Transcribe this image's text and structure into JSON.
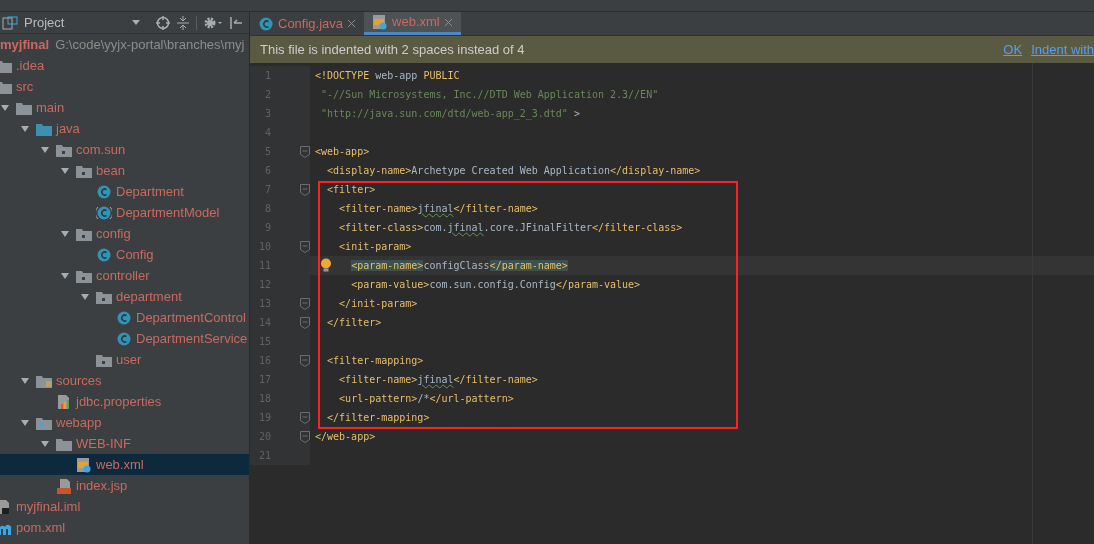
{
  "project_panel": {
    "title": "Project",
    "root": {
      "name": "myjfinal",
      "path": "G:\\code\\yyjx-portal\\branches\\myj"
    },
    "tree": [
      {
        "name": ".idea",
        "kind": "folder",
        "selected": false
      },
      {
        "name": "src",
        "kind": "folder",
        "selected": false,
        "children": [
          {
            "name": "main",
            "kind": "folder",
            "expanded": true,
            "selected": false,
            "children": [
              {
                "name": "java",
                "kind": "source-folder",
                "expanded": true,
                "selected": false,
                "children": [
                  {
                    "name": "com.sun",
                    "kind": "package",
                    "expanded": true,
                    "selected": false,
                    "children": [
                      {
                        "name": "bean",
                        "kind": "package",
                        "expanded": true,
                        "selected": false,
                        "children": [
                          {
                            "name": "Department",
                            "kind": "class",
                            "selected": false
                          },
                          {
                            "name": "DepartmentModel",
                            "kind": "abstract-class",
                            "selected": false
                          }
                        ]
                      },
                      {
                        "name": "config",
                        "kind": "package",
                        "expanded": true,
                        "selected": false,
                        "children": [
                          {
                            "name": "Config",
                            "kind": "class",
                            "selected": false
                          }
                        ]
                      },
                      {
                        "name": "controller",
                        "kind": "package",
                        "expanded": true,
                        "selected": false,
                        "children": [
                          {
                            "name": "department",
                            "kind": "package",
                            "expanded": true,
                            "selected": false,
                            "children": [
                              {
                                "name": "DepartmentControl",
                                "kind": "class",
                                "selected": false
                              },
                              {
                                "name": "DepartmentService",
                                "kind": "class",
                                "selected": false
                              }
                            ]
                          },
                          {
                            "name": "user",
                            "kind": "package",
                            "selected": false
                          }
                        ]
                      }
                    ]
                  }
                ]
              },
              {
                "name": "sources",
                "kind": "resource-folder",
                "expanded": true,
                "selected": false,
                "children": [
                  {
                    "name": "jdbc.properties",
                    "kind": "properties",
                    "selected": false
                  }
                ]
              },
              {
                "name": "webapp",
                "kind": "web-folder",
                "expanded": true,
                "selected": false,
                "children": [
                  {
                    "name": "WEB-INF",
                    "kind": "folder",
                    "expanded": true,
                    "selected": false,
                    "children": [
                      {
                        "name": "web.xml",
                        "kind": "xml",
                        "selected": true
                      }
                    ]
                  },
                  {
                    "name": "index.jsp",
                    "kind": "jsp",
                    "selected": false
                  }
                ]
              }
            ]
          }
        ]
      },
      {
        "name": "myjfinal.iml",
        "kind": "iml",
        "selected": false
      },
      {
        "name": "pom.xml",
        "kind": "maven",
        "selected": false
      }
    ]
  },
  "tabs": [
    {
      "label": "Config.java",
      "kind": "class",
      "selected": false
    },
    {
      "label": "web.xml",
      "kind": "xml",
      "selected": true
    }
  ],
  "notification": {
    "message": "This file is indented with 2 spaces instead of 4",
    "actions": [
      "OK",
      "Indent with"
    ]
  },
  "editor": {
    "lines": [
      {
        "number": "1",
        "fold": false,
        "current": false,
        "segments": [
          {
            "kind": "tag",
            "text": "<!DOCTYPE "
          },
          {
            "kind": "text",
            "text": "web-app "
          },
          {
            "kind": "tag",
            "text": "PUBLIC"
          }
        ]
      },
      {
        "number": "2",
        "fold": false,
        "current": false,
        "segments": [
          {
            "kind": "string",
            "text": " \"-//Sun Microsystems, Inc.//DTD Web Application 2.3//EN\""
          }
        ]
      },
      {
        "number": "3",
        "fold": false,
        "current": false,
        "segments": [
          {
            "kind": "string",
            "text": " \"http://java.sun.com/dtd/web-app_2_3.dtd\""
          },
          {
            "kind": "text",
            "text": " >"
          }
        ]
      },
      {
        "number": "4",
        "fold": false,
        "current": false
      },
      {
        "number": "5",
        "fold": true,
        "current": false,
        "segments": [
          {
            "kind": "tag",
            "text": "<web-app>"
          }
        ]
      },
      {
        "number": "6",
        "fold": false,
        "current": false,
        "segments": [
          {
            "kind": "tag",
            "text": "  <display-name>"
          },
          {
            "kind": "text",
            "text": "Archetype Created Web Application"
          },
          {
            "kind": "tag",
            "text": "</display-name>"
          }
        ]
      },
      {
        "number": "7",
        "fold": true,
        "current": false,
        "segments": [
          {
            "kind": "tag",
            "text": "  <filter>"
          }
        ]
      },
      {
        "number": "8",
        "fold": false,
        "current": false,
        "segments": [
          {
            "kind": "tag",
            "text": "    <filter-name>"
          },
          {
            "kind": "text",
            "text": "jfinal",
            "typo": true
          },
          {
            "kind": "tag",
            "text": "</filter-name>"
          }
        ]
      },
      {
        "number": "9",
        "fold": false,
        "current": false,
        "segments": [
          {
            "kind": "tag",
            "text": "    <filter-class>"
          },
          {
            "kind": "text",
            "text": "com."
          },
          {
            "kind": "text",
            "text": "jfinal",
            "typo": true
          },
          {
            "kind": "text",
            "text": ".core.JFinalFilter"
          },
          {
            "kind": "tag",
            "text": "</filter-class>"
          }
        ]
      },
      {
        "number": "10",
        "fold": true,
        "current": false,
        "segments": [
          {
            "kind": "tag",
            "text": "    <init-param>"
          }
        ]
      },
      {
        "number": "11",
        "fold": false,
        "current": true,
        "intention": true,
        "segments": [
          {
            "kind": "tag",
            "text": "      <param-name>",
            "matched": true
          },
          {
            "kind": "text",
            "text": "configClass"
          },
          {
            "kind": "tag",
            "text": "</param-name>",
            "matched": true
          }
        ]
      },
      {
        "number": "12",
        "fold": false,
        "current": false,
        "segments": [
          {
            "kind": "tag",
            "text": "      <param-value>"
          },
          {
            "kind": "text",
            "text": "com.sun.config.Config"
          },
          {
            "kind": "tag",
            "text": "</param-value>"
          }
        ]
      },
      {
        "number": "13",
        "fold": true,
        "current": false,
        "segments": [
          {
            "kind": "tag",
            "text": "    </init-param>"
          }
        ]
      },
      {
        "number": "14",
        "fold": true,
        "current": false,
        "segments": [
          {
            "kind": "tag",
            "text": "  </filter>"
          }
        ]
      },
      {
        "number": "15",
        "fold": false,
        "current": false
      },
      {
        "number": "16",
        "fold": true,
        "current": false,
        "segments": [
          {
            "kind": "tag",
            "text": "  <filter-mapping>"
          }
        ]
      },
      {
        "number": "17",
        "fold": false,
        "current": false,
        "segments": [
          {
            "kind": "tag",
            "text": "    <filter-name>"
          },
          {
            "kind": "text",
            "text": "jfinal",
            "typo": true
          },
          {
            "kind": "tag",
            "text": "</filter-name>"
          }
        ]
      },
      {
        "number": "18",
        "fold": false,
        "current": false,
        "segments": [
          {
            "kind": "tag",
            "text": "    <url-pattern>"
          },
          {
            "kind": "text",
            "text": "/*"
          },
          {
            "kind": "tag",
            "text": "</url-pattern>"
          }
        ]
      },
      {
        "number": "19",
        "fold": true,
        "current": false,
        "segments": [
          {
            "kind": "tag",
            "text": "  </filter-mapping>"
          }
        ]
      },
      {
        "number": "20",
        "fold": true,
        "current": false,
        "segments": [
          {
            "kind": "tag",
            "text": "</web-app>"
          }
        ]
      },
      {
        "number": "21",
        "fold": false,
        "current": false
      }
    ]
  }
}
